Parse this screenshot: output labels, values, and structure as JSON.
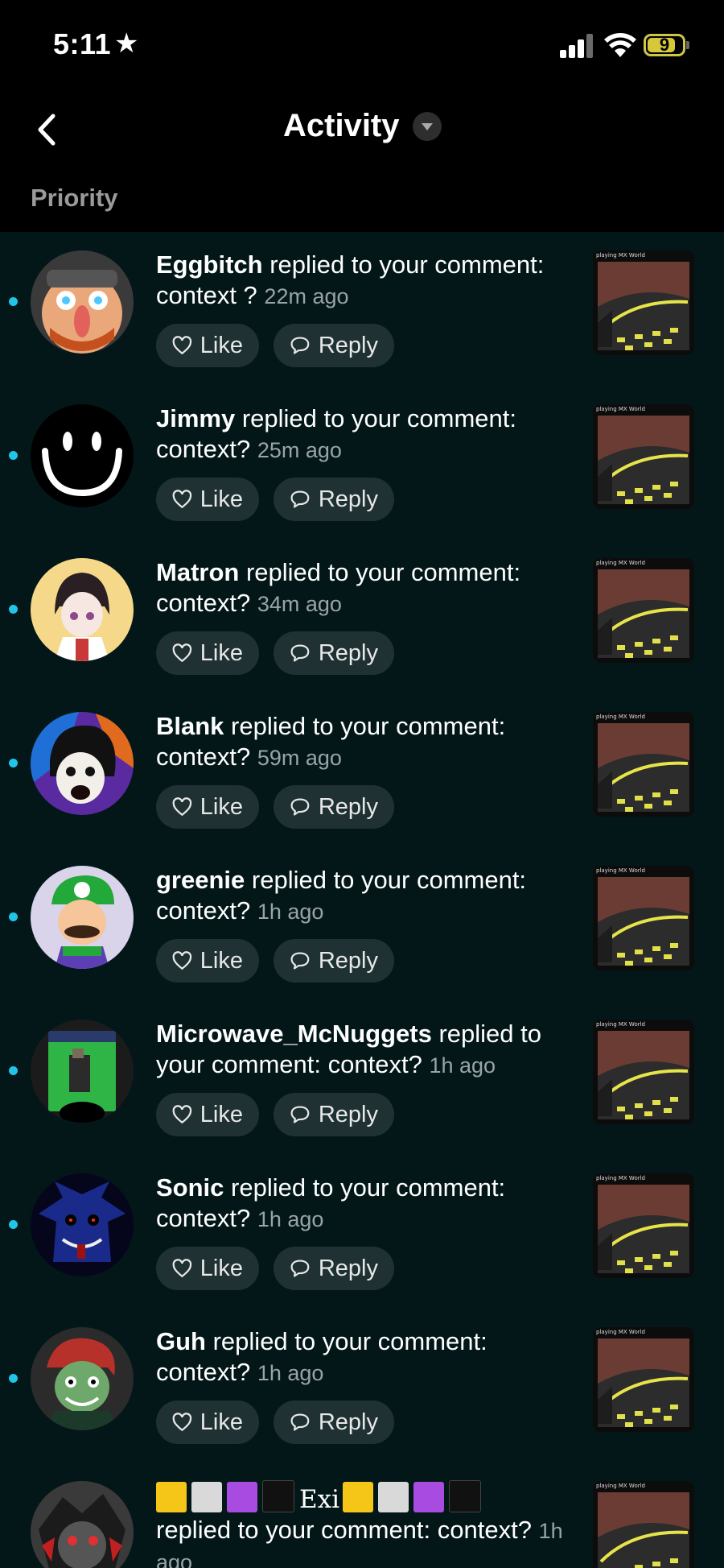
{
  "status_bar": {
    "time": "5:11",
    "battery": "9"
  },
  "header": {
    "title": "Activity",
    "section": "Priority"
  },
  "notifications": [
    {
      "username": "Eggbitch",
      "message": " replied to your comment: context ? ",
      "time_ago": "22m ago",
      "like_label": "Like",
      "reply_label": "Reply"
    },
    {
      "username": "Jimmy",
      "message": " replied to your comment: context? ",
      "time_ago": "25m ago",
      "like_label": "Like",
      "reply_label": "Reply"
    },
    {
      "username": "Matron",
      "message": " replied to your comment: context? ",
      "time_ago": "34m ago",
      "like_label": "Like",
      "reply_label": "Reply"
    },
    {
      "username": "Blank",
      "message": " replied to your comment: context? ",
      "time_ago": "59m ago",
      "like_label": "Like",
      "reply_label": "Reply"
    },
    {
      "username": "greenie",
      "message": " replied to your comment: context? ",
      "time_ago": "1h ago",
      "like_label": "Like",
      "reply_label": "Reply"
    },
    {
      "username": "Microwave_McNuggets",
      "message": " replied to your comment: context? ",
      "time_ago": "1h ago",
      "like_label": "Like",
      "reply_label": "Reply"
    },
    {
      "username": "Sonic",
      "message": " replied to your comment: context? ",
      "time_ago": "1h ago",
      "like_label": "Like",
      "reply_label": "Reply"
    },
    {
      "username": "Guh",
      "message": " replied to your comment: context? ",
      "time_ago": "1h ago",
      "like_label": "Like",
      "reply_label": "Reply"
    },
    {
      "username": "Exi",
      "message": "replied to your comment: context? ",
      "time_ago": "1h ago"
    }
  ],
  "thumbnail_caption": "playing MX World",
  "colors": {
    "background": "#031719",
    "header": "#000000",
    "button": "#1f3133",
    "unread": "#20c5e8"
  }
}
